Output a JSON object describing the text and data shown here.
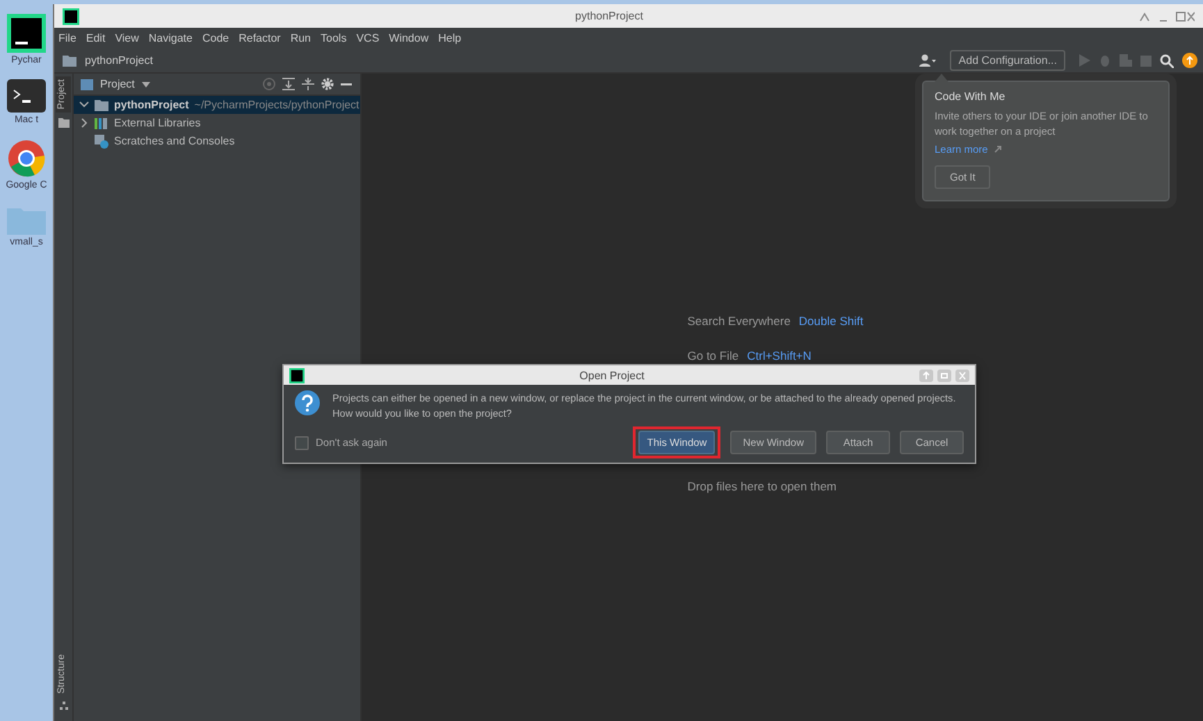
{
  "desktop_icons": [
    {
      "label": "Pychar",
      "kind": "app"
    },
    {
      "label": "Mac t",
      "kind": "terminal"
    },
    {
      "label": "Google C",
      "kind": "browser"
    },
    {
      "label": "vmall_s",
      "kind": "folder"
    }
  ],
  "window": {
    "title": "pythonProject"
  },
  "menu": [
    "File",
    "Edit",
    "View",
    "Navigate",
    "Code",
    "Refactor",
    "Run",
    "Tools",
    "VCS",
    "Window",
    "Help"
  ],
  "breadcrumb": "pythonProject",
  "toolbar": {
    "add_configuration": "Add Configuration..."
  },
  "left_strip": {
    "top": "Project",
    "bottom": "Structure"
  },
  "project_panel": {
    "title": "Project",
    "tree": [
      {
        "label": "pythonProject",
        "path": "~/PycharmProjects/pythonProject",
        "kind": "folder",
        "expanded": true,
        "selected": true
      },
      {
        "label": "External Libraries",
        "kind": "library",
        "expanded": false,
        "selected": false
      },
      {
        "label": "Scratches and Consoles",
        "kind": "scratch",
        "selected": false
      }
    ]
  },
  "hints": [
    {
      "label": "Search Everywhere",
      "shortcut": "Double Shift"
    },
    {
      "label": "Go to File",
      "shortcut": "Ctrl+Shift+N"
    },
    {
      "label": "Drop files here to open them"
    }
  ],
  "popup": {
    "title": "Code With Me",
    "text": "Invite others to your IDE or join another IDE to work together on a project",
    "link": "Learn more",
    "button": "Got It"
  },
  "dialog": {
    "title": "Open Project",
    "message_lines": [
      "Projects can either be opened in a new window, or replace the project in the current window, or be attached to the already opened projects.",
      "How would you like to open the project?"
    ],
    "checkbox": {
      "label": "Don't ask again",
      "checked": false
    },
    "buttons": [
      {
        "label": "This Window",
        "selected": true
      },
      {
        "label": "New Window",
        "selected": false
      },
      {
        "label": "Attach",
        "selected": false
      },
      {
        "label": "Cancel",
        "selected": false
      }
    ]
  }
}
